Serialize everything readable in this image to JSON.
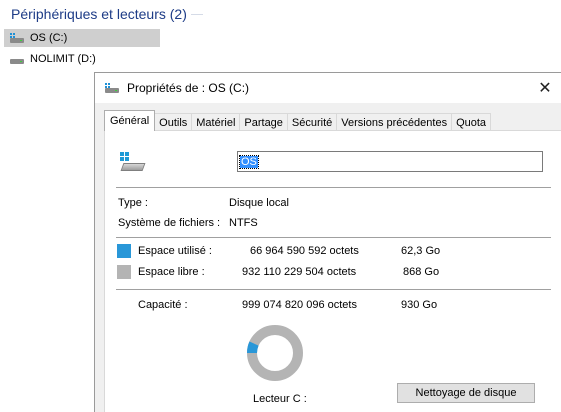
{
  "explorer": {
    "section_header": "Périphériques et lecteurs (2)",
    "drives": [
      {
        "label": "OS (C:)",
        "selected": true
      },
      {
        "label": "NOLIMIT (D:)",
        "selected": false
      }
    ]
  },
  "dialog": {
    "title": "Propriétés de : OS (C:)",
    "close_glyph": "✕",
    "tabs": [
      "Général",
      "Outils",
      "Matériel",
      "Partage",
      "Sécurité",
      "Versions précédentes",
      "Quota"
    ],
    "active_tab": "Général",
    "name_value": "OS",
    "type_label": "Type :",
    "type_value": "Disque local",
    "fs_label": "Système de fichiers :",
    "fs_value": "NTFS",
    "used_label": "Espace utilisé :",
    "used_bytes": "66 964 590 592 octets",
    "used_human": "62,3 Go",
    "free_label": "Espace libre :",
    "free_bytes": "932 110 229 504 octets",
    "free_human": "868 Go",
    "capacity_label": "Capacité :",
    "capacity_bytes": "999 074 820 096 octets",
    "capacity_human": "930 Go",
    "drive_label": "Lecteur C :",
    "cleanup_button": "Nettoyage de disque",
    "used_fraction": 0.067
  },
  "colors": {
    "used": "#2997d8",
    "free": "#b4b4b4",
    "header_text": "#1e3c87",
    "selection": "#cfcfcf"
  },
  "icons": {
    "drive": "drive-icon",
    "windows_drive": "windows-drive-icon",
    "close": "close-icon"
  }
}
